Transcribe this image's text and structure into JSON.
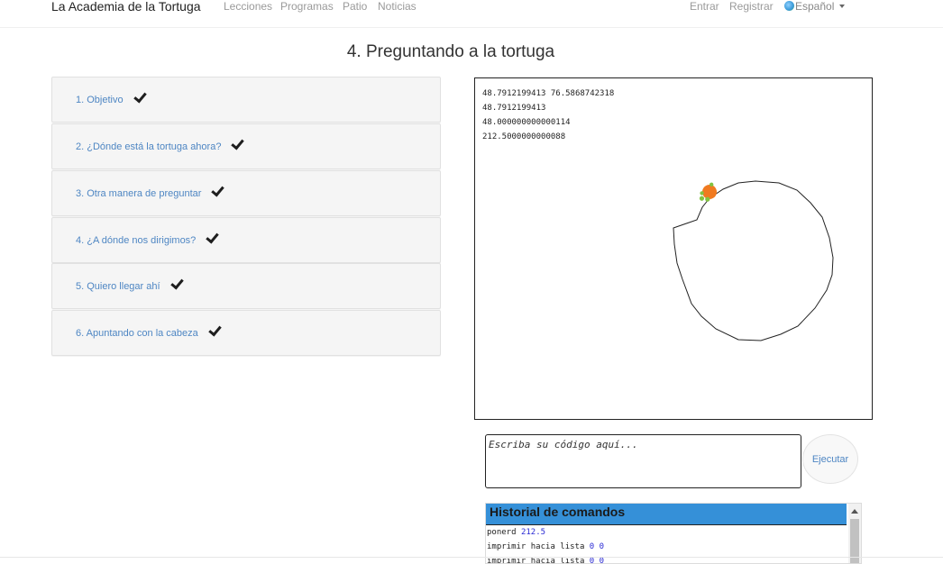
{
  "navbar": {
    "brand": "La Academia de la Tortuga",
    "links": [
      "Lecciones",
      "Programas",
      "Patio",
      "Noticias"
    ],
    "login": "Entrar",
    "register": "Registrar",
    "language": "Español"
  },
  "page": {
    "title": "4. Preguntando a la tortuga"
  },
  "accordion": {
    "items": [
      {
        "label": "1. Objetivo",
        "done": true
      },
      {
        "label": "2. ¿Dónde está la tortuga ahora?",
        "done": true
      },
      {
        "label": "3. Otra manera de preguntar",
        "done": true
      },
      {
        "label": "4. ¿A dónde nos dirigimos?",
        "done": true
      },
      {
        "label": "5. Quiero llegar ahí",
        "done": true
      },
      {
        "label": "6. Apuntando con la cabeza",
        "done": true
      }
    ]
  },
  "console": {
    "lines": [
      "48.7912199413 76.5868742318",
      "48.7912199413",
      "48.000000000000114",
      "212.5000000000088"
    ]
  },
  "code": {
    "placeholder": "Escriba su código aquí...",
    "run_label": "Ejecutar"
  },
  "history": {
    "title": "Historial de comandos",
    "lines": [
      {
        "cmd": "ponerd",
        "arg": "212.5"
      },
      {
        "cmd": "imprimir hacia lista",
        "arg": "0 0"
      },
      {
        "cmd": "imprimir hacia lista",
        "arg": "0 0"
      }
    ]
  },
  "colors": {
    "link": "#4e86c3",
    "history_header": "#3590d8",
    "turtle": "#f07a20"
  }
}
